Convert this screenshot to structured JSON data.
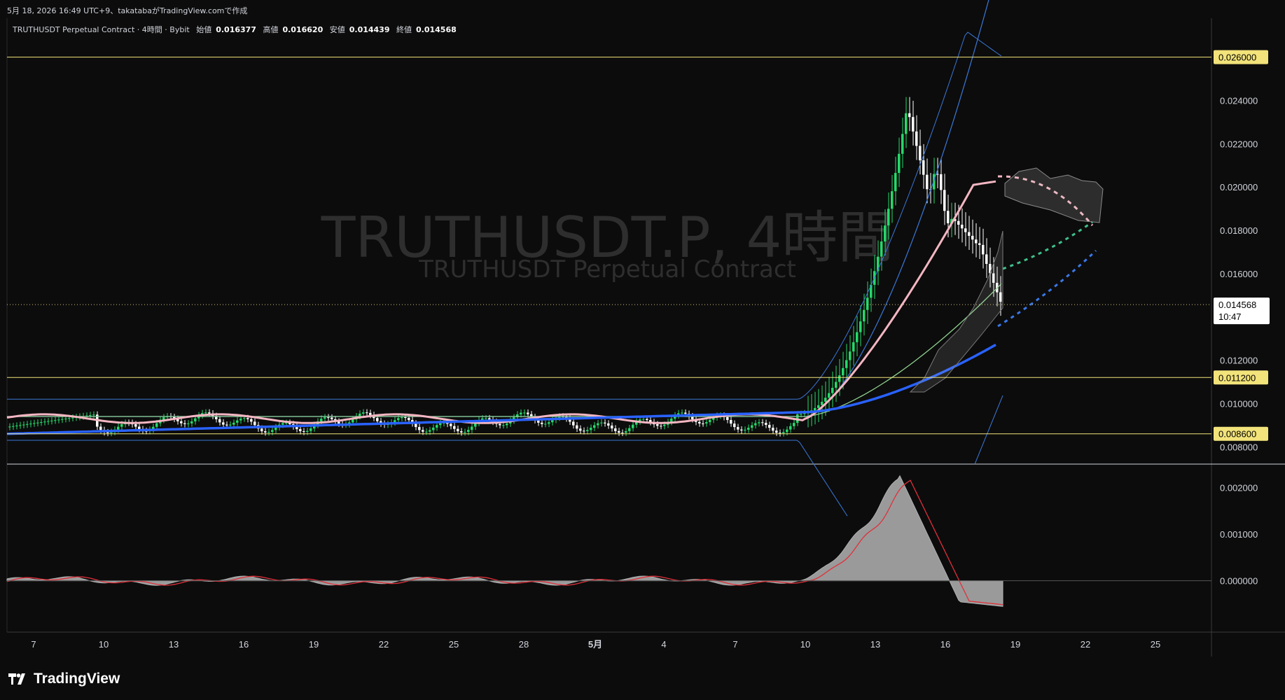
{
  "caption": "5月 18, 2026 16:49 UTC+9、takatabaがTradingView.comで作成",
  "info": {
    "symbol_line": "TRUTHUSDT Perpetual Contract · 4時間 · Bybit",
    "open_label": "始値",
    "open": "0.016377",
    "high_label": "高値",
    "high": "0.016620",
    "low_label": "安値",
    "low": "0.014439",
    "close_label": "終値",
    "close": "0.014568"
  },
  "watermark": {
    "title": "TRUTHUSDT.P, 4時間",
    "subtitle": "TRUTHUSDT Perpetual Contract"
  },
  "brand": "TradingView",
  "colors": {
    "background": "#0c0c0c",
    "grid": "#1a1a1a",
    "up": "#26d96a",
    "down": "#ffffff",
    "hline": "#f2e37a",
    "ema_pink": "#f4b6c2",
    "ema_blue": "#2962ff",
    "ma_green": "#8fd18f",
    "bb": "#3a78d8",
    "violet": "#c878d0",
    "macd_hist": "#9a9a9a",
    "macd_signal": "#e0303a"
  },
  "chart_data": {
    "type": "candlestick",
    "timeframe": "4時間",
    "x_ticks": [
      "7",
      "10",
      "13",
      "16",
      "19",
      "22",
      "25",
      "28",
      "5月",
      "4",
      "7",
      "10",
      "13",
      "16",
      "19",
      "22",
      "25"
    ],
    "y_ticks": [
      "0.024000",
      "0.022000",
      "0.020000",
      "0.018000",
      "0.016000",
      "0.012000",
      "0.010000",
      "0.008000"
    ],
    "ylim": [
      0.0072,
      0.0278
    ],
    "horizontal_levels": [
      {
        "value": 0.026,
        "label": "0.026000"
      },
      {
        "value": 0.0112,
        "label": "0.011200"
      },
      {
        "value": 0.0086,
        "label": "0.008600"
      }
    ],
    "last_price": {
      "value": 0.014568,
      "label": "0.014568",
      "countdown": "10:47"
    },
    "ohlc": {
      "open": 0.016377,
      "high": 0.01662,
      "low": 0.014439,
      "close": 0.014568
    },
    "macd_pane": {
      "y_ticks": [
        "0.002000",
        "0.001000",
        "0.000000"
      ],
      "ylim": [
        -0.0011,
        0.0025
      ]
    }
  }
}
